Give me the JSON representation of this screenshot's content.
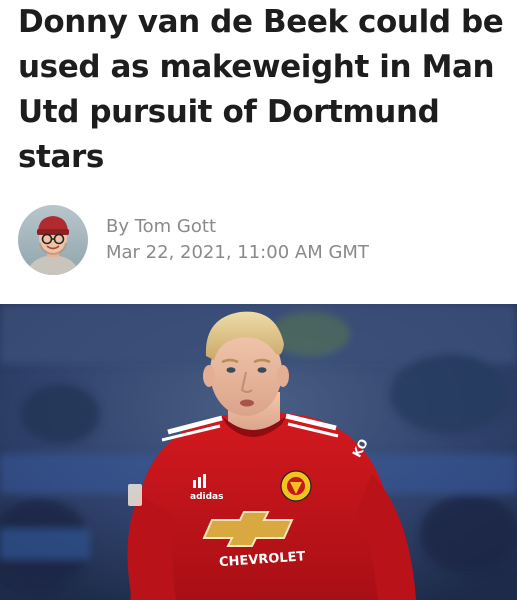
{
  "article": {
    "headline": "Donny van de Beek could be used as makeweight in Man Utd pursuit of Dortmund stars",
    "author": "By Tom Gott",
    "date": "Mar 22, 2021, 11:00 AM GMT"
  },
  "hero_image": {
    "sponsor_text": "CHEVROLET",
    "kit_brand_text": "adidas",
    "sleeve_text": "KO"
  },
  "colors": {
    "headline": "#1d1d1d",
    "meta": "#8a8a8a",
    "kit_red": "#c8161d",
    "stadium_blue": "#2b3f6e"
  }
}
